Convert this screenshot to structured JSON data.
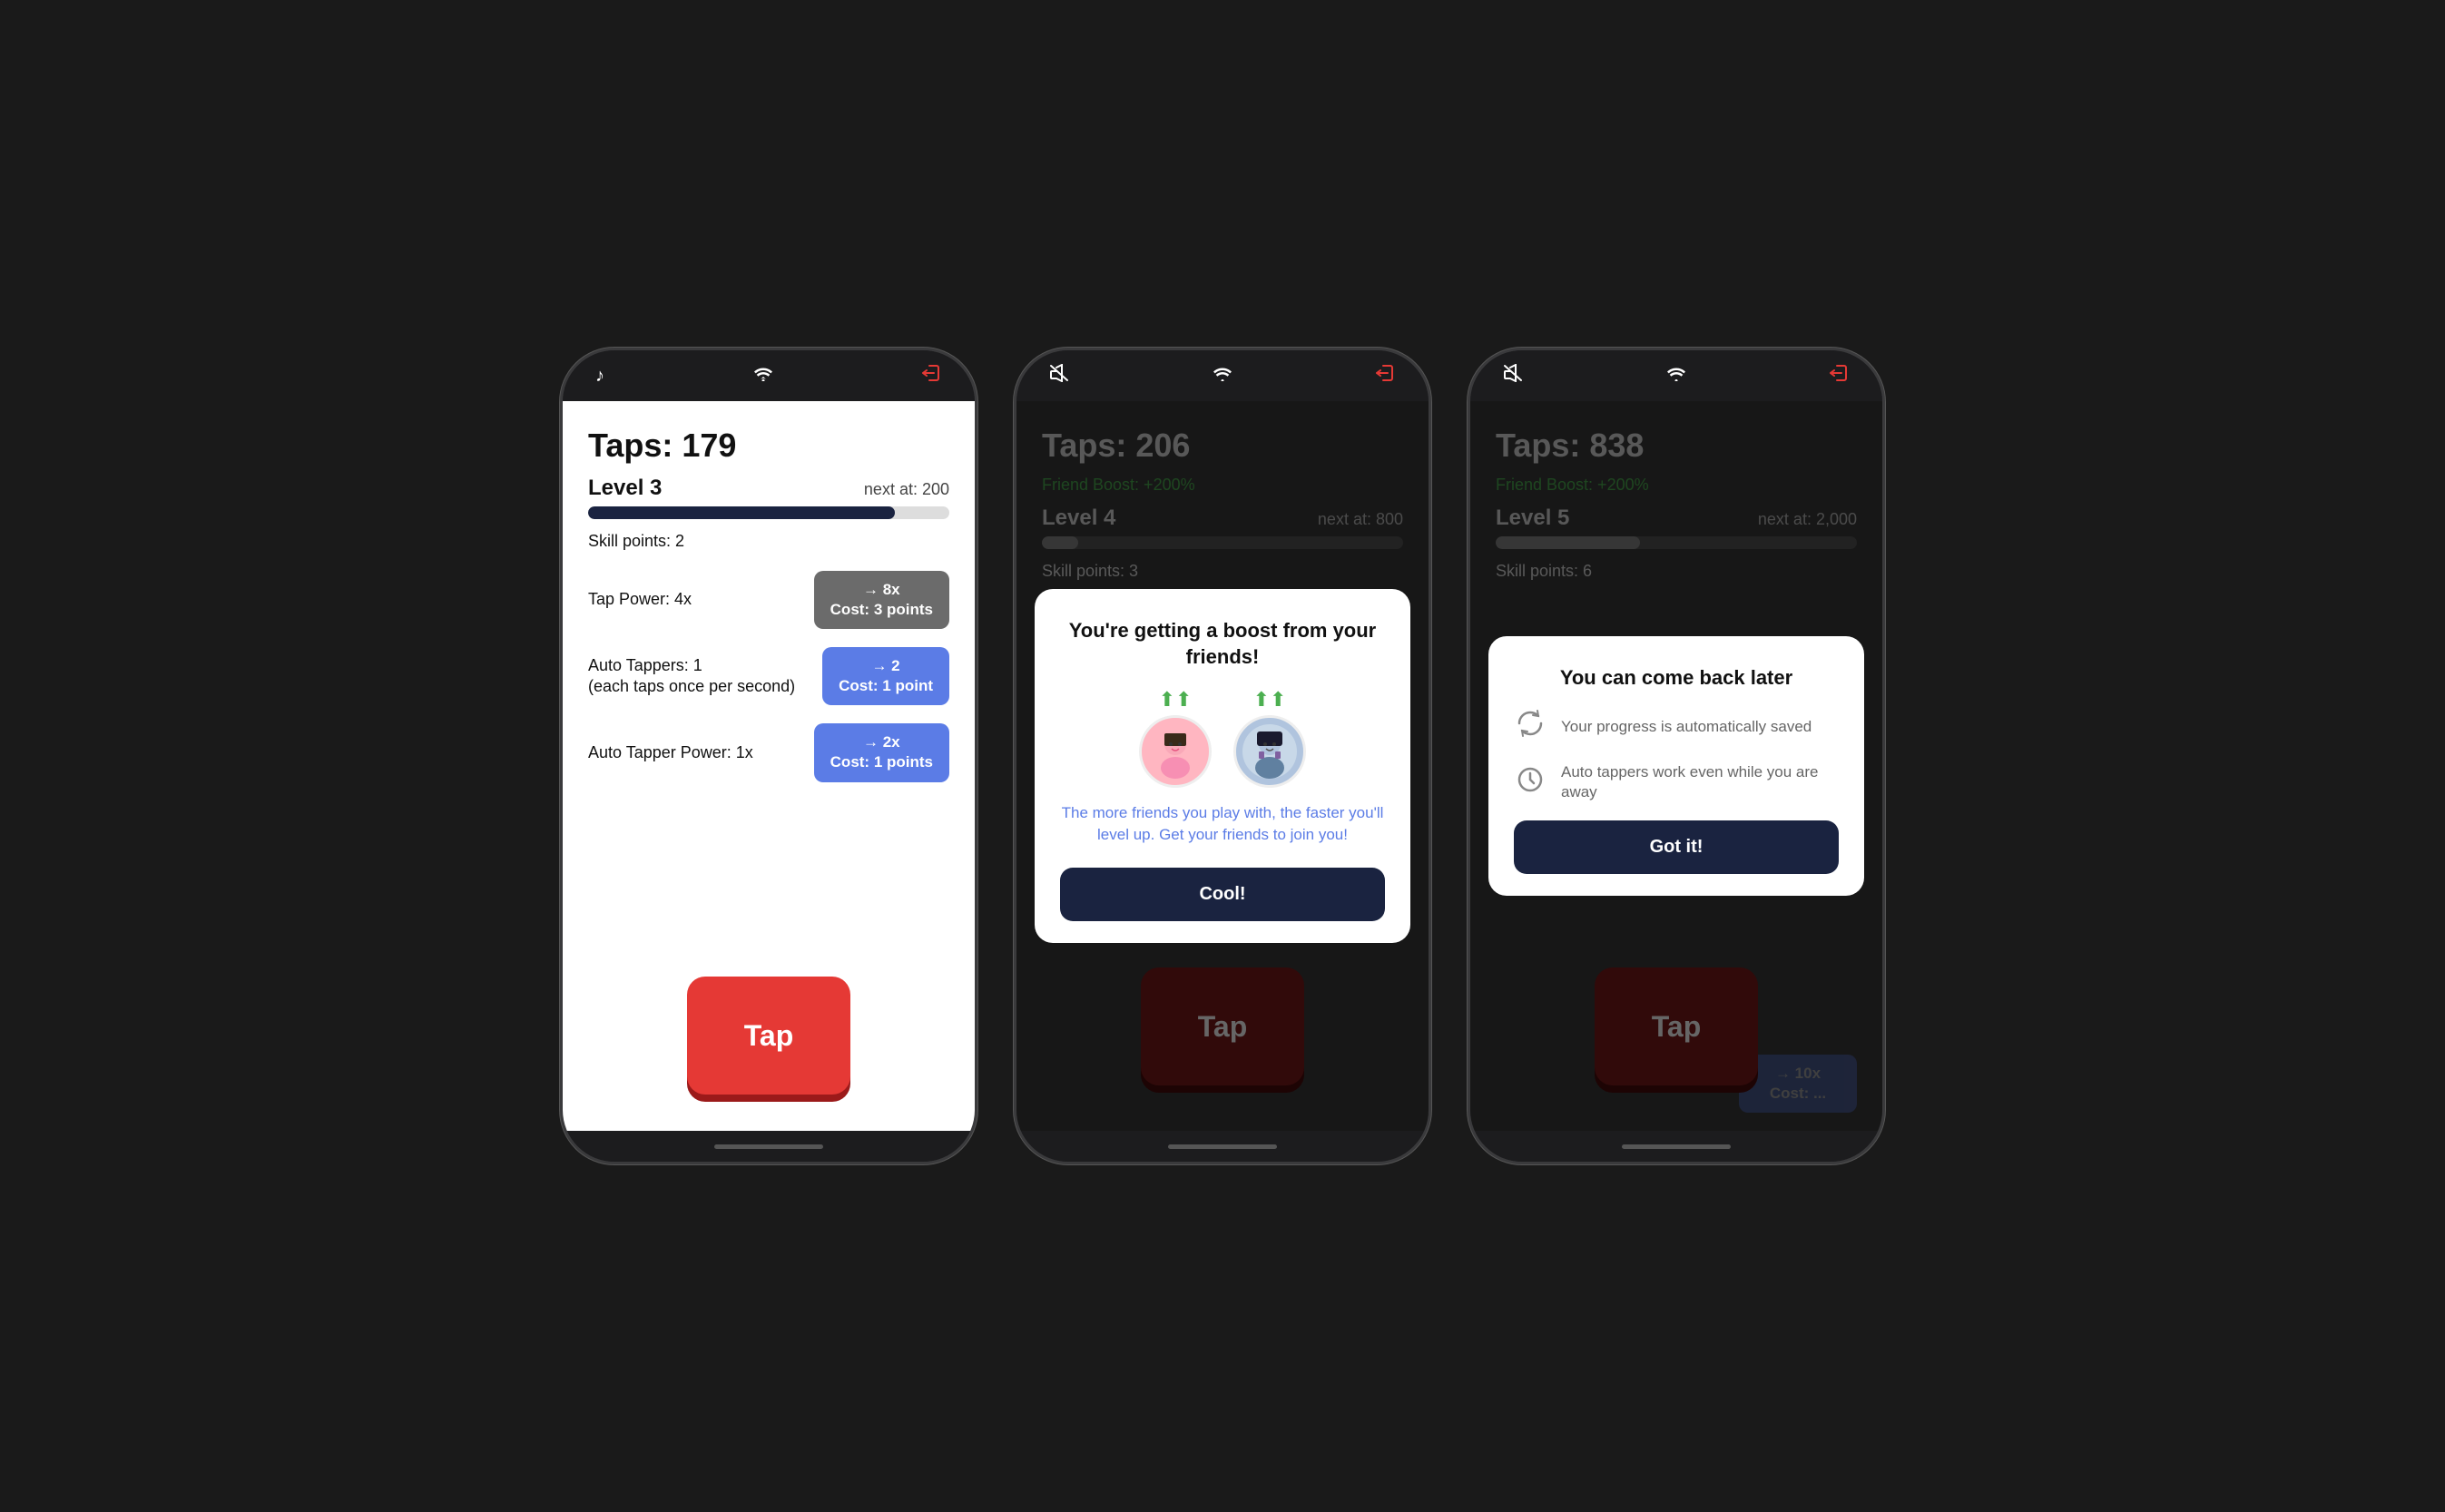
{
  "phone1": {
    "status_bar": {
      "music_icon": "♪",
      "wifi_icon": "wifi",
      "exit_icon": "exit"
    },
    "taps_label": "Taps: 179",
    "level_label": "Level 3",
    "next_at": "next at: 200",
    "progress_percent": 85,
    "skill_points": "Skill points: 2",
    "tap_power_label": "Tap Power: 4x",
    "tap_power_btn_line1": "→ 8x",
    "tap_power_btn_line2": "Cost: 3 points",
    "auto_tappers_label": "Auto Tappers: 1\n(each taps once per second)",
    "auto_tappers_btn_line1": "→ 2",
    "auto_tappers_btn_line2": "Cost: 1 point",
    "auto_tapper_power_label": "Auto Tapper Power: 1x",
    "auto_tapper_power_btn_line1": "→ 2x",
    "auto_tapper_power_btn_line2": "Cost: 1 points",
    "tap_button": "Tap"
  },
  "phone2": {
    "taps_label": "Taps: 206",
    "friend_boost": "Friend Boost: +200%",
    "level_label": "Level 4",
    "next_at": "next at: 800",
    "progress_percent": 10,
    "skill_points": "Skill points: 3",
    "tap_button": "Tap",
    "modal": {
      "title": "You're getting a boost from your friends!",
      "desc": "The more friends you play with, the faster you'll level up. Get your friends to join you!",
      "btn_label": "Cool!",
      "avatar1_emoji": "👧",
      "avatar2_emoji": "👦",
      "boost_arrow": "⬆"
    }
  },
  "phone3": {
    "taps_label": "Taps: 838",
    "friend_boost": "Friend Boost: +200%",
    "level_label": "Level 5",
    "next_at": "next at: 2,000",
    "progress_percent": 40,
    "skill_points": "Skill points: 6",
    "tap_button": "Tap",
    "modal": {
      "title": "You can come back later",
      "feature1_text": "Your progress is automatically saved",
      "feature2_text": "Auto tappers work even while you are away",
      "btn_label": "Got it!",
      "refresh_icon": "↺",
      "clock_icon": "🕐"
    }
  }
}
